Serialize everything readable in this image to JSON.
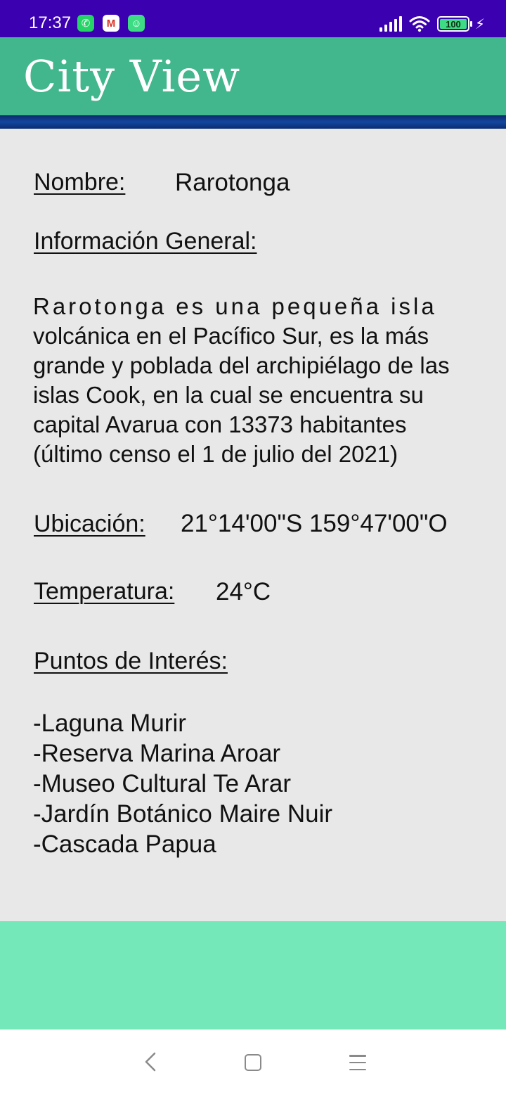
{
  "status_bar": {
    "time": "17:37",
    "notifications": [
      {
        "icon": "whatsapp-icon",
        "glyph": "✆"
      },
      {
        "icon": "gmail-icon",
        "glyph": "M"
      },
      {
        "icon": "android-icon",
        "glyph": "☺"
      }
    ],
    "battery_level": "100",
    "signal_icon": "signal-icon",
    "wifi_icon": "wifi-icon",
    "charging_icon": "charging-bolt-icon"
  },
  "app_bar": {
    "title": "City View"
  },
  "city": {
    "name_label": "Nombre:",
    "name_value": "Rarotonga",
    "info_label": "Información General:",
    "description_first_line": "Rarotonga es una pequeña isla",
    "description_rest": "volcánica en el Pacífico Sur, es la más grande y poblada del archipiélago de las islas Cook, en la cual se encuentra su capital Avarua con 13373 habitantes (último censo el 1 de julio del 2021)",
    "location_label": "Ubicación:",
    "location_value": "21°14'00\"S 159°47'00\"O",
    "temperature_label": "Temperatura:",
    "temperature_value": "24°C",
    "poi_label": "Puntos de Interés:",
    "points_of_interest": [
      "-Laguna Murir",
      "-Reserva Marina Aroar",
      "-Museo Cultural Te Arar",
      "-Jardín Botánico Maire Nuir",
      "-Cascada Papua"
    ]
  },
  "colors": {
    "status_bar": "#3b00b0",
    "app_bar": "#42b68c",
    "content_bg": "#e8e8e8",
    "footer_band": "#74e8b8"
  },
  "nav_bar": {
    "back_icon": "back-icon",
    "home_icon": "home-icon",
    "recents_icon": "menu-icon"
  }
}
